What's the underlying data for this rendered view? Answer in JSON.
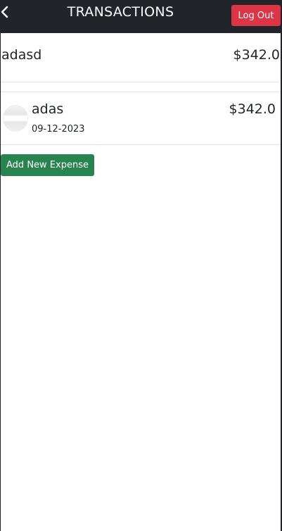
{
  "header": {
    "title": "TRANSACTIONS",
    "back_icon": "chevron-left-icon",
    "logout_label": "Log Out"
  },
  "transactions": [
    {
      "name": "adasd",
      "amount": "$342.0"
    },
    {
      "name": "adas",
      "amount": "$342.0",
      "date": "09-12-2023"
    }
  ],
  "actions": {
    "add_label": "Add New Expense"
  },
  "colors": {
    "header_bg": "#212529",
    "logout_bg": "#dc3545",
    "add_bg": "#28844f",
    "text": "#212529"
  }
}
